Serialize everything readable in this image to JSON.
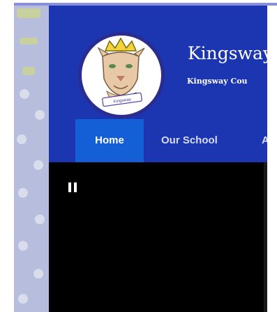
{
  "site": {
    "title": "Kingsway",
    "subtitle": "Kingsway Cou"
  },
  "nav": {
    "items": [
      {
        "label": "Home"
      },
      {
        "label": "Our School"
      },
      {
        "label": "A"
      }
    ],
    "active": "Home"
  },
  "video": {
    "control_icon": "pause-icon"
  },
  "logo": {
    "banner_text": "Kingsway",
    "icon": "cougar-mascot-logo"
  },
  "colors": {
    "header_bg": "#1c35b0",
    "nav_active": "#155fd6",
    "video_bg": "#000000"
  }
}
